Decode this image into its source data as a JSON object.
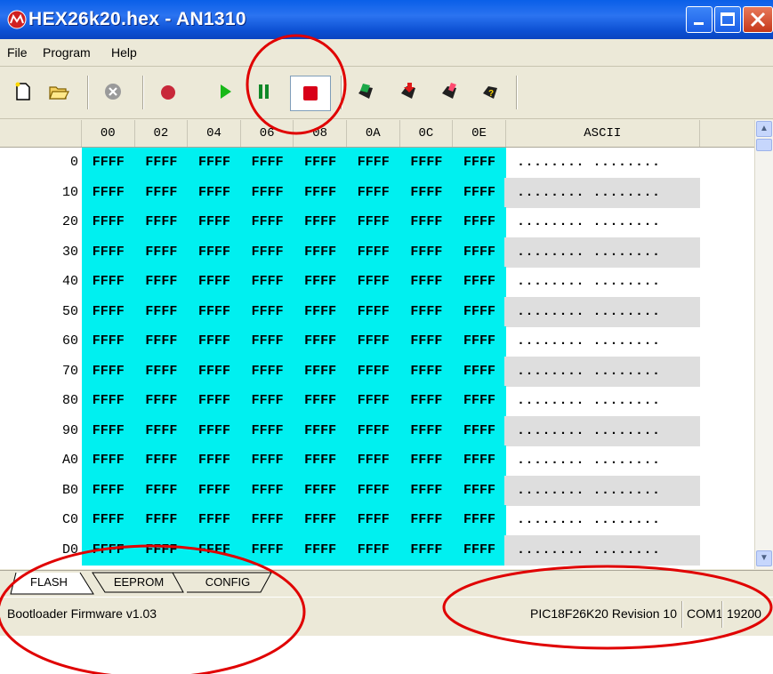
{
  "window": {
    "title": "HEX26k20.hex - AN1310",
    "controls": {
      "minimize": "minimize",
      "maximize": "maximize",
      "close": "close"
    }
  },
  "menu": [
    "File",
    "Program",
    "Help"
  ],
  "toolbar": {
    "icons": [
      "new-file-icon",
      "open-folder-icon",
      "cancel-icon",
      "record-icon",
      "run-icon",
      "pause-icon",
      "stop-icon",
      "write-device-icon",
      "read-device-icon",
      "erase-device-icon",
      "verify-device-icon"
    ]
  },
  "grid": {
    "headers": [
      "00",
      "02",
      "04",
      "06",
      "08",
      "0A",
      "0C",
      "0E",
      "ASCII"
    ],
    "rows": [
      {
        "addr": "0",
        "cells": [
          "FFFF",
          "FFFF",
          "FFFF",
          "FFFF",
          "FFFF",
          "FFFF",
          "FFFF",
          "FFFF"
        ],
        "ascii": "........ ........"
      },
      {
        "addr": "10",
        "cells": [
          "FFFF",
          "FFFF",
          "FFFF",
          "FFFF",
          "FFFF",
          "FFFF",
          "FFFF",
          "FFFF"
        ],
        "ascii": "........ ........"
      },
      {
        "addr": "20",
        "cells": [
          "FFFF",
          "FFFF",
          "FFFF",
          "FFFF",
          "FFFF",
          "FFFF",
          "FFFF",
          "FFFF"
        ],
        "ascii": "........ ........"
      },
      {
        "addr": "30",
        "cells": [
          "FFFF",
          "FFFF",
          "FFFF",
          "FFFF",
          "FFFF",
          "FFFF",
          "FFFF",
          "FFFF"
        ],
        "ascii": "........ ........"
      },
      {
        "addr": "40",
        "cells": [
          "FFFF",
          "FFFF",
          "FFFF",
          "FFFF",
          "FFFF",
          "FFFF",
          "FFFF",
          "FFFF"
        ],
        "ascii": "........ ........"
      },
      {
        "addr": "50",
        "cells": [
          "FFFF",
          "FFFF",
          "FFFF",
          "FFFF",
          "FFFF",
          "FFFF",
          "FFFF",
          "FFFF"
        ],
        "ascii": "........ ........"
      },
      {
        "addr": "60",
        "cells": [
          "FFFF",
          "FFFF",
          "FFFF",
          "FFFF",
          "FFFF",
          "FFFF",
          "FFFF",
          "FFFF"
        ],
        "ascii": "........ ........"
      },
      {
        "addr": "70",
        "cells": [
          "FFFF",
          "FFFF",
          "FFFF",
          "FFFF",
          "FFFF",
          "FFFF",
          "FFFF",
          "FFFF"
        ],
        "ascii": "........ ........"
      },
      {
        "addr": "80",
        "cells": [
          "FFFF",
          "FFFF",
          "FFFF",
          "FFFF",
          "FFFF",
          "FFFF",
          "FFFF",
          "FFFF"
        ],
        "ascii": "........ ........"
      },
      {
        "addr": "90",
        "cells": [
          "FFFF",
          "FFFF",
          "FFFF",
          "FFFF",
          "FFFF",
          "FFFF",
          "FFFF",
          "FFFF"
        ],
        "ascii": "........ ........"
      },
      {
        "addr": "A0",
        "cells": [
          "FFFF",
          "FFFF",
          "FFFF",
          "FFFF",
          "FFFF",
          "FFFF",
          "FFFF",
          "FFFF"
        ],
        "ascii": "........ ........"
      },
      {
        "addr": "B0",
        "cells": [
          "FFFF",
          "FFFF",
          "FFFF",
          "FFFF",
          "FFFF",
          "FFFF",
          "FFFF",
          "FFFF"
        ],
        "ascii": "........ ........"
      },
      {
        "addr": "C0",
        "cells": [
          "FFFF",
          "FFFF",
          "FFFF",
          "FFFF",
          "FFFF",
          "FFFF",
          "FFFF",
          "FFFF"
        ],
        "ascii": "........ ........"
      },
      {
        "addr": "D0",
        "cells": [
          "FFFF",
          "FFFF",
          "FFFF",
          "FFFF",
          "FFFF",
          "FFFF",
          "FFFF",
          "FFFF"
        ],
        "ascii": "........ ........"
      }
    ]
  },
  "tabs": [
    "FLASH",
    "EEPROM",
    "CONFIG"
  ],
  "active_tab": "FLASH",
  "status": {
    "firmware": "Bootloader Firmware v1.03",
    "device": "PIC18F26K20 Revision 10",
    "port": "COM1",
    "baud": "19200"
  },
  "colors": {
    "hex_cell_bg": "#00f0f0",
    "ascii_alt_bg": "#dedede",
    "annotation": "#e00000",
    "title_bar": "#0a5fe8"
  }
}
